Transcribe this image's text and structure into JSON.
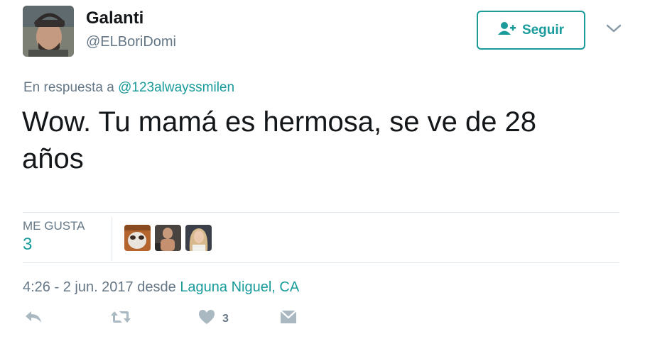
{
  "tweet": {
    "author": {
      "display_name": "Galanti",
      "handle": "@ELBoriDomi"
    },
    "follow_button": {
      "label": "Seguir"
    },
    "reply_to": {
      "prefix": "En respuesta a",
      "mention": "@123alwayssmilen"
    },
    "text": "Wow. Tu mamá es hermosa, se ve de 28 años",
    "likes": {
      "label": "ME GUSTA",
      "count": "3"
    },
    "timestamp": {
      "time_date": "4:26 - 2 jun. 2017",
      "from": "desde",
      "place": "Laguna Niguel, CA"
    },
    "actions": {
      "reply_icon": "reply-icon",
      "retweet_icon": "retweet-icon",
      "like_icon": "heart-icon",
      "like_count": "3",
      "dm_icon": "envelope-icon"
    },
    "colors": {
      "accent": "#1a9b9b",
      "muted": "#657786",
      "text": "#14171a",
      "divider": "#e1e8ed"
    }
  }
}
